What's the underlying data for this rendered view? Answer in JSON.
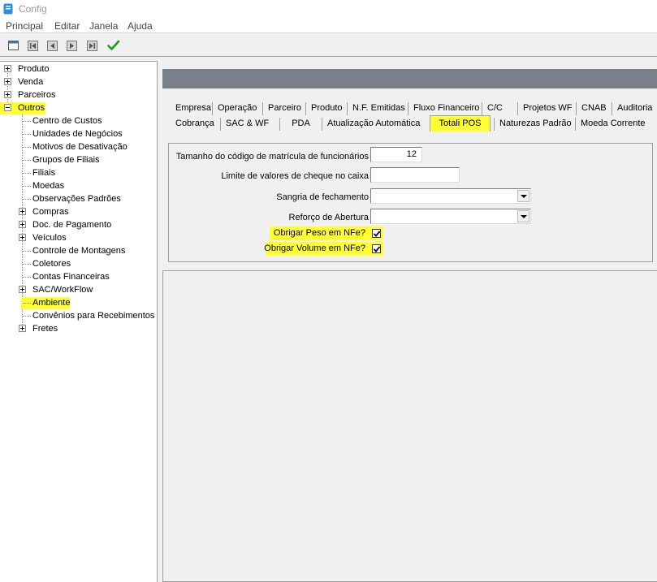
{
  "window": {
    "title": "Config"
  },
  "menu": [
    "Principal",
    "Editar",
    "Janela",
    "Ajuda"
  ],
  "toolbar": {
    "buttons": [
      "new-icon",
      "first-icon",
      "prev-icon",
      "next-icon",
      "last-icon",
      "confirm-icon"
    ],
    "confirm_color": "#1a9a1a"
  },
  "tree": {
    "root_items": [
      "Produto",
      "Venda",
      "Parceiros",
      "Outros"
    ],
    "outros_children": [
      "Centro de Custos",
      "Unidades de Negócios",
      "Motivos de Desativação",
      "Grupos de Filiais",
      "Filiais",
      "Moedas",
      "Observações Padrões",
      "Compras",
      "Doc. de Pagamento",
      "Veículos",
      "Controle de Montagens",
      "Coletores",
      "Contas Financeiras",
      "SAC/WorkFlow",
      "Ambiente",
      "Convênios para Recebimentos c",
      "Fretes"
    ],
    "highlight_color": "#ffff33"
  },
  "tabs": {
    "row1": [
      "Empresa",
      "Operação",
      "Parceiro",
      "Produto",
      "N.F. Emitidas",
      "Fluxo Financeiro",
      "C/C",
      "Projetos WF",
      "CNAB",
      "Auditoria"
    ],
    "row2": [
      "Cobrança",
      "SAC & WF",
      "PDA",
      "Atualização Automática",
      "Totali POS",
      "Naturezas Padrão",
      "Moeda Corrente"
    ],
    "active": "Totali POS"
  },
  "form": {
    "matricula_label": "Tamanho do código de matrícula de funcionários",
    "matricula_value": "12",
    "cheque_label": "Limite de valores de cheque no caixa",
    "cheque_value": "",
    "sangria_label": "Sangria de fechamento",
    "sangria_value": "",
    "reforco_label": "Reforço de Abertura",
    "reforco_value": "",
    "peso_label": "Obrigar Peso em NFe?",
    "peso_checked": true,
    "volume_label": "Obrigar Volume em NFe?",
    "volume_checked": true
  }
}
